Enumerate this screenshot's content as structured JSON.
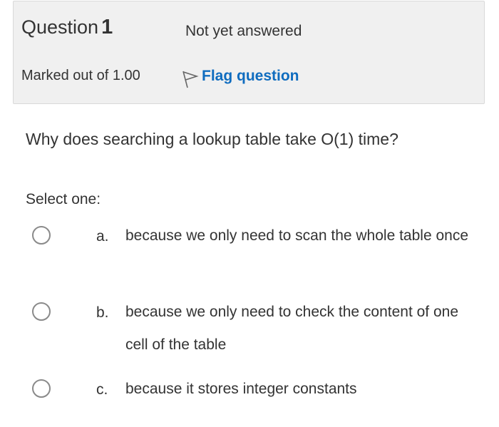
{
  "header": {
    "question_label": "Question",
    "question_number": "1",
    "state": "Not yet answered",
    "grade": "Marked out of 1.00",
    "flag_label": "Flag question"
  },
  "question": {
    "text": "Why does searching a lookup table take O(1) time?",
    "prompt": "Select one:"
  },
  "options": [
    {
      "letter": "a.",
      "text": "because we only need to scan the whole table once"
    },
    {
      "letter": "b.",
      "text": "because we only need to check the content of one cell of the table"
    },
    {
      "letter": "c.",
      "text": "because it stores integer constants"
    }
  ],
  "colors": {
    "link": "#0f6cbf",
    "info_bg": "#f0f0f0",
    "text": "#333333"
  },
  "icons": [
    "flag-icon",
    "radio-icon"
  ]
}
